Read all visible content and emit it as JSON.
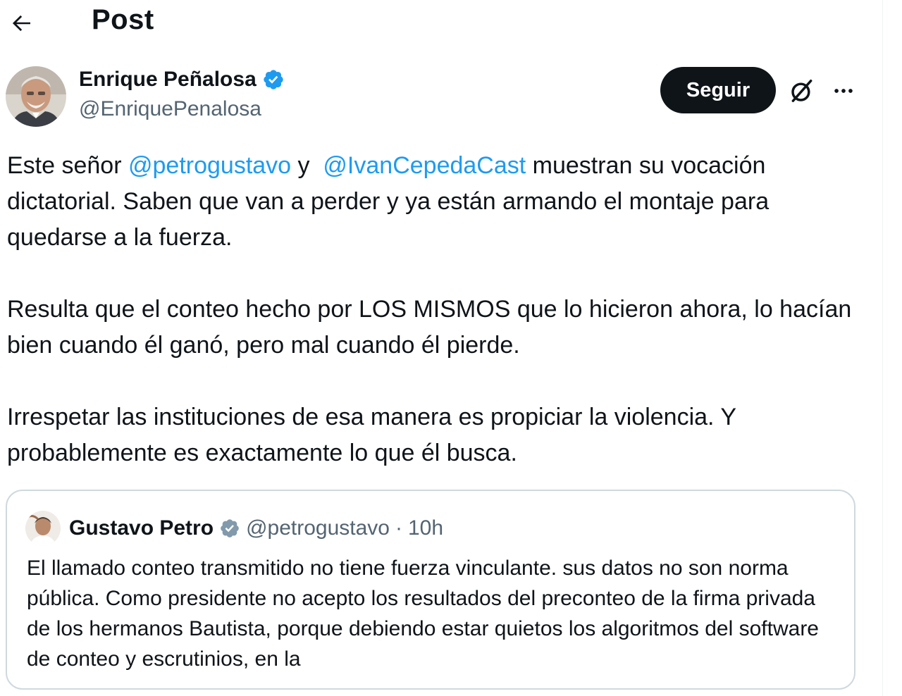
{
  "header": {
    "title": "Post"
  },
  "author": {
    "name": "Enrique Peñalosa",
    "handle": "@EnriquePenalosa",
    "verified": true
  },
  "actions": {
    "follow_label": "Seguir"
  },
  "tweet": {
    "p1_before": "Este señor ",
    "mention1": "@petrogustavo",
    "p1_mid": " y  ",
    "mention2": "@IvanCepedaCast",
    "p1_after": " muestran su vocación dictatorial. Saben que van a perder y ya están armando el montaje para quedarse a la fuerza.",
    "p2": "Resulta que el conteo hecho por LOS MISMOS que lo hicieron ahora, lo hacían bien cuando él ganó, pero mal cuando él pierde.",
    "p3": "Irrespetar las instituciones de esa manera es propiciar la violencia. Y probablemente es exactamente lo que él busca."
  },
  "quote": {
    "name": "Gustavo Petro",
    "handle": "@petrogustavo",
    "separator": "·",
    "time": "10h",
    "text": "El llamado conteo transmitido no tiene fuerza vinculante. sus datos no son norma pública. Como presidente no acepto los resultados del preconteo de la firma privada  de los hermanos Bautista, porque debiendo estar quietos los algoritmos del software de conteo y escrutinios, en la"
  },
  "colors": {
    "text": "#0f1419",
    "secondary": "#536471",
    "link": "#1d9bf0",
    "verified_blue": "#1d9bf0",
    "verified_gray": "#829aab",
    "border": "#cfd9de"
  },
  "icons": {
    "back": "arrow-left-icon",
    "verified": "verified-badge-icon",
    "grok": "grok-icon",
    "more": "more-dots-icon"
  }
}
